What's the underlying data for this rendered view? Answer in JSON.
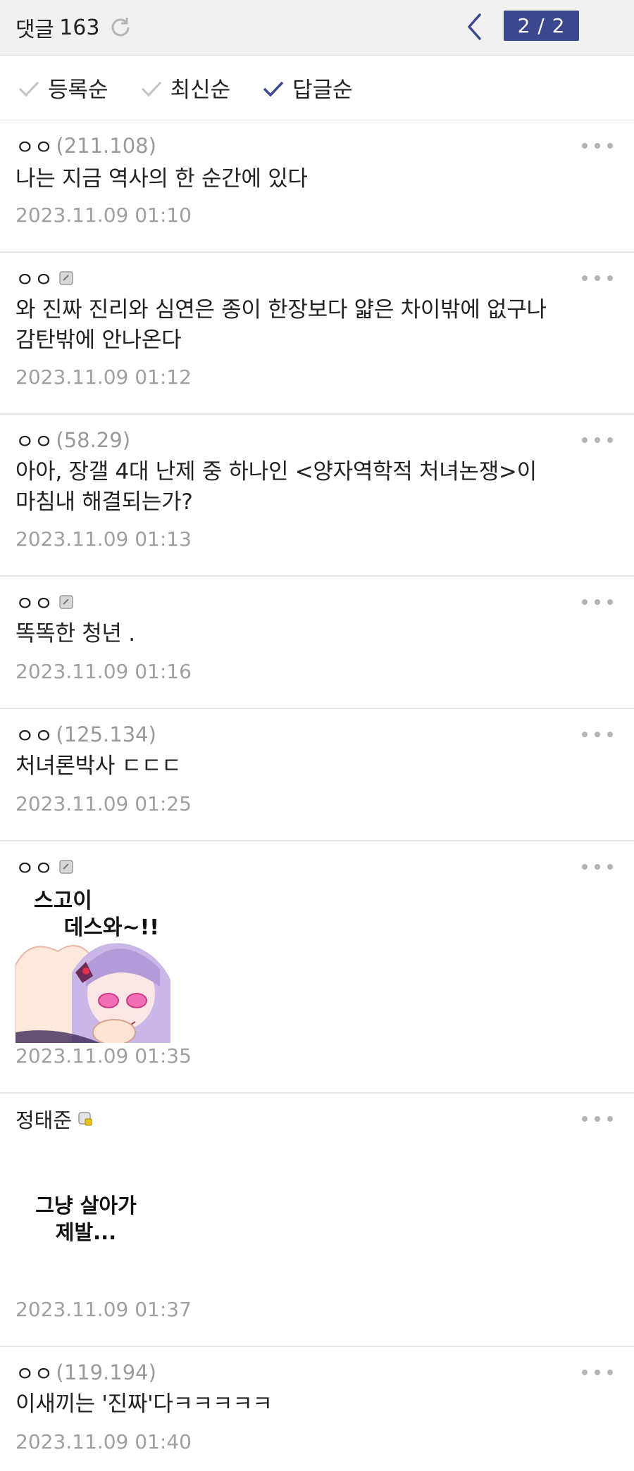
{
  "header": {
    "title": "댓글",
    "count": "163",
    "page": "2 / 2"
  },
  "sort": {
    "options": [
      "등록순",
      "최신순",
      "답글순"
    ],
    "active": "답글순"
  },
  "comments": [
    {
      "author": "ㅇㅇ",
      "ip": "(211.108)",
      "text": "나는 지금 역사의 한 순간에 있다",
      "time": "2023.11.09 01:10"
    },
    {
      "author": "ㅇㅇ",
      "text_lines": [
        "와 진짜 진리와 심연은 종이 한장보다 얇은 차이밖에 없구나",
        "감탄밖에 안나온다"
      ],
      "time": "2023.11.09 01:12"
    },
    {
      "author": "ㅇㅇ",
      "ip": "(58.29)",
      "text_lines": [
        "아아, 장갤 4대 난제 중 하나인 <양자역학적 처녀논쟁>이",
        "마침내 해결되는가?"
      ],
      "time": "2023.11.09 01:13"
    },
    {
      "author": "ㅇㅇ",
      "text": "똑똑한 청년 .",
      "time": "2023.11.09 01:16"
    },
    {
      "author": "ㅇㅇ",
      "ip": "(125.134)",
      "text": "처녀론박사 ㄷㄷㄷ",
      "time": "2023.11.09 01:25"
    },
    {
      "author": "ㅇㅇ",
      "sticker_lines": [
        "스고이",
        "데스와~!!"
      ],
      "time": "2023.11.09 01:35"
    },
    {
      "author": "정태준",
      "sticker_lines": [
        "그냥 살아가",
        "제발..."
      ],
      "time": "2023.11.09 01:37"
    },
    {
      "author": "ㅇㅇ",
      "ip": "(119.194)",
      "text": "이새끼는 '진짜'다ㅋㅋㅋㅋㅋ",
      "time": "2023.11.09 01:40"
    }
  ],
  "colors": {
    "accent": "#3b4890",
    "muted": "#9a9a9a",
    "divider": "#e6e6e6"
  }
}
